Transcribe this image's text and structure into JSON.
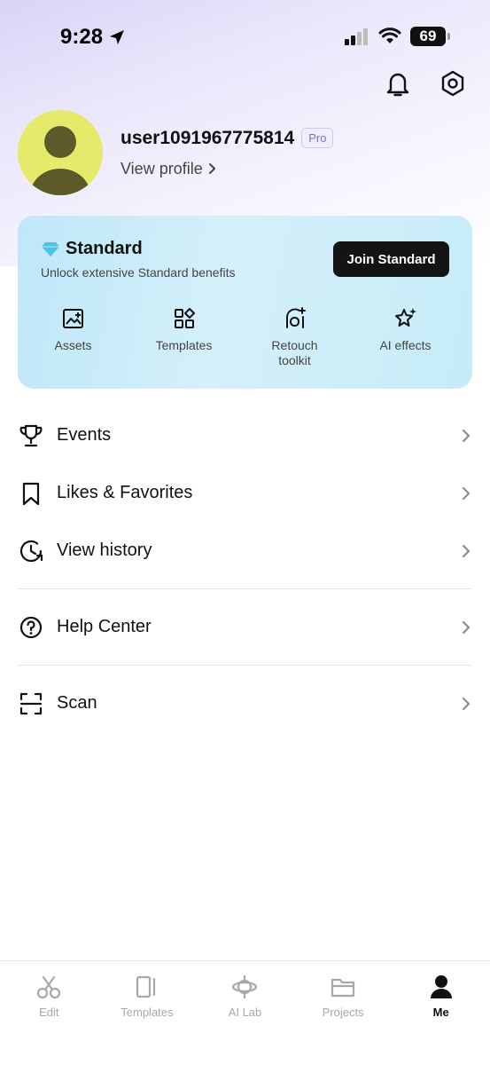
{
  "status_bar": {
    "time": "9:28",
    "battery": "69"
  },
  "profile": {
    "username": "user1091967775814",
    "badge": "Pro",
    "view_profile": "View profile"
  },
  "standard": {
    "title": "Standard",
    "subtitle": "Unlock extensive Standard benefits",
    "join_label": "Join Standard",
    "benefits": [
      {
        "label": "Assets",
        "icon": "image-plus-icon"
      },
      {
        "label": "Templates",
        "icon": "grid-icon"
      },
      {
        "label": "Retouch\ntoolkit",
        "icon": "face-retouch-icon"
      },
      {
        "label": "AI effects",
        "icon": "sparkle-icon"
      }
    ]
  },
  "menu": [
    {
      "label": "Events",
      "icon": "trophy-icon"
    },
    {
      "label": "Likes & Favorites",
      "icon": "bookmark-icon"
    },
    {
      "label": "View history",
      "icon": "history-icon"
    },
    {
      "label": "Help Center",
      "icon": "help-circle-icon"
    },
    {
      "label": "Scan",
      "icon": "scan-icon"
    }
  ],
  "tabs": [
    {
      "label": "Edit",
      "icon": "scissors-icon"
    },
    {
      "label": "Templates",
      "icon": "template-icon"
    },
    {
      "label": "AI Lab",
      "icon": "ai-lab-icon"
    },
    {
      "label": "Projects",
      "icon": "folder-icon"
    },
    {
      "label": "Me",
      "icon": "person-icon",
      "active": true
    }
  ]
}
